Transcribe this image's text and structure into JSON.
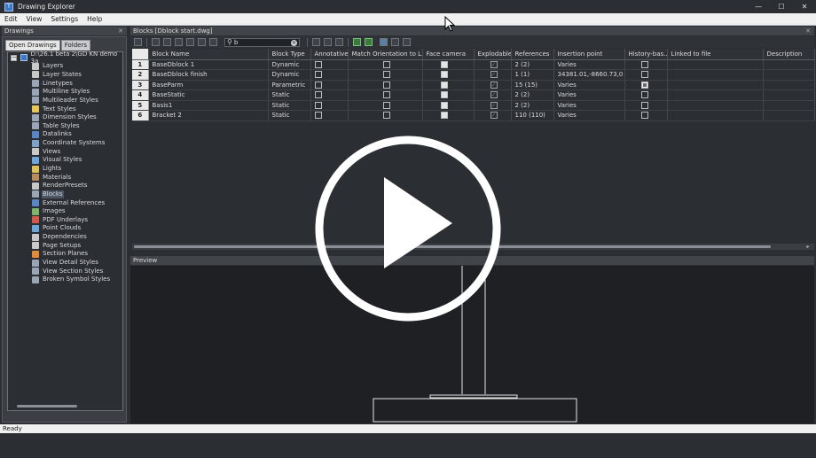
{
  "window": {
    "title": "Drawing Explorer",
    "controls": [
      "minimize",
      "maximize",
      "close"
    ]
  },
  "menubar": [
    "Edit",
    "View",
    "Settings",
    "Help"
  ],
  "drawings_panel": {
    "title": "Drawings",
    "tabs": [
      "Open Drawings",
      "Folders"
    ],
    "root_label": "D:\\26.1 beta 2\\GD KN demo 3a",
    "items": [
      {
        "label": "Layers",
        "icon": "layers-icon",
        "color": "#c9c9c9"
      },
      {
        "label": "Layer States",
        "icon": "layer-states-icon",
        "color": "#c9c9c9"
      },
      {
        "label": "Linetypes",
        "icon": "linetypes-icon",
        "color": "#9aa5b8"
      },
      {
        "label": "Multiline Styles",
        "icon": "multiline-styles-icon",
        "color": "#9aa5b8"
      },
      {
        "label": "Multileader Styles",
        "icon": "multileader-styles-icon",
        "color": "#9aa5b8"
      },
      {
        "label": "Text Styles",
        "icon": "text-styles-icon",
        "color": "#e6c65a"
      },
      {
        "label": "Dimension Styles",
        "icon": "dimension-styles-icon",
        "color": "#9aa5b8"
      },
      {
        "label": "Table Styles",
        "icon": "table-styles-icon",
        "color": "#9aa5b8"
      },
      {
        "label": "Datalinks",
        "icon": "datalinks-icon",
        "color": "#5b86c6"
      },
      {
        "label": "Coordinate Systems",
        "icon": "coordinate-systems-icon",
        "color": "#7fa0c8"
      },
      {
        "label": "Views",
        "icon": "views-icon",
        "color": "#c9c9c9"
      },
      {
        "label": "Visual Styles",
        "icon": "visual-styles-icon",
        "color": "#6fa6d9"
      },
      {
        "label": "Lights",
        "icon": "lights-icon",
        "color": "#e0c25a"
      },
      {
        "label": "Materials",
        "icon": "materials-icon",
        "color": "#b98b5a"
      },
      {
        "label": "RenderPresets",
        "icon": "render-presets-icon",
        "color": "#c9c9c9"
      },
      {
        "label": "Blocks",
        "icon": "blocks-icon",
        "color": "#9aa5b8",
        "selected": true
      },
      {
        "label": "External References",
        "icon": "external-references-icon",
        "color": "#5b86c6"
      },
      {
        "label": "Images",
        "icon": "images-icon",
        "color": "#7fb36a"
      },
      {
        "label": "PDF Underlays",
        "icon": "pdf-underlays-icon",
        "color": "#d05a4a"
      },
      {
        "label": "Point Clouds",
        "icon": "point-clouds-icon",
        "color": "#6fa6d9"
      },
      {
        "label": "Dependencies",
        "icon": "dependencies-icon",
        "color": "#c9c9c9"
      },
      {
        "label": "Page Setups",
        "icon": "page-setups-icon",
        "color": "#c9c9c9"
      },
      {
        "label": "Section Planes",
        "icon": "section-planes-icon",
        "color": "#e08a3a"
      },
      {
        "label": "View Detail Styles",
        "icon": "view-detail-styles-icon",
        "color": "#9aa5b8"
      },
      {
        "label": "View Section Styles",
        "icon": "view-section-styles-icon",
        "color": "#9aa5b8"
      },
      {
        "label": "Broken Symbol Styles",
        "icon": "broken-symbol-styles-icon",
        "color": "#9aa5b8"
      }
    ]
  },
  "blocks_panel": {
    "title": "Blocks [Dblock start.dwg]",
    "search_value": "b",
    "columns": [
      "",
      "Block Name",
      "Block Type",
      "Annotative",
      "Match Orientation to L...",
      "Face camera",
      "Explodable",
      "References",
      "Insertion point",
      "History-bas...",
      "Linked to file",
      "Description"
    ],
    "rows": [
      {
        "num": "1",
        "name": "BaseDblock 1",
        "type": "Dynamic",
        "annotative": "off",
        "match": "off",
        "face": "filled",
        "explodable": "checked",
        "refs": "2 (2)",
        "insertion": "Varies",
        "history": "off"
      },
      {
        "num": "2",
        "name": "BaseDblock finish",
        "type": "Dynamic",
        "annotative": "off",
        "match": "off",
        "face": "filled",
        "explodable": "checked",
        "refs": "1 (1)",
        "insertion": "34381.01,-8660.73,0",
        "history": "off"
      },
      {
        "num": "3",
        "name": "BaseParm",
        "type": "Parametric",
        "annotative": "off",
        "match": "off",
        "face": "filled",
        "explodable": "checked",
        "refs": "15 (15)",
        "insertion": "Varies",
        "history": "on"
      },
      {
        "num": "4",
        "name": "BaseStatic",
        "type": "Static",
        "annotative": "off",
        "match": "off",
        "face": "filled",
        "explodable": "checked",
        "refs": "2 (2)",
        "insertion": "Varies",
        "history": "off"
      },
      {
        "num": "5",
        "name": "Basis1",
        "type": "Static",
        "annotative": "off",
        "match": "off",
        "face": "filled",
        "explodable": "checked",
        "refs": "2 (2)",
        "insertion": "Varies",
        "history": "off"
      },
      {
        "num": "6",
        "name": "Bracket 2",
        "type": "Static",
        "annotative": "off",
        "match": "off",
        "face": "filled",
        "explodable": "checked",
        "refs": "110 (110)",
        "insertion": "Varies",
        "history": "off"
      }
    ]
  },
  "preview_panel": {
    "title": "Preview"
  },
  "status": {
    "text": "Ready"
  },
  "overlay": {
    "type": "video-play-button",
    "icon": "play-icon"
  }
}
